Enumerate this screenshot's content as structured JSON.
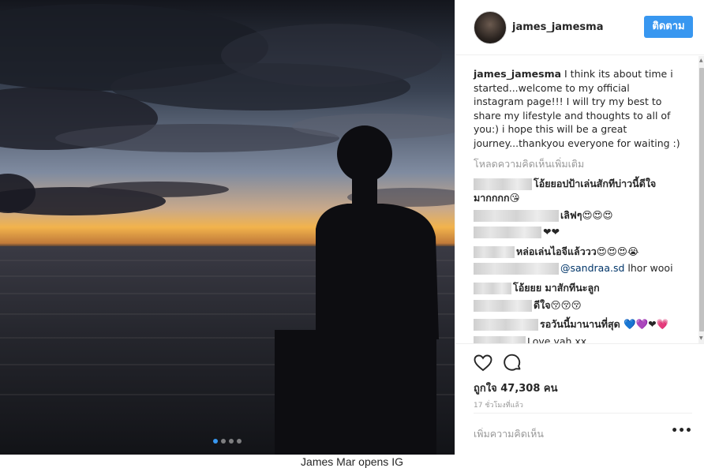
{
  "post": {
    "username": "james_jamesma",
    "follow_label": "ติดตาม",
    "caption_user": "james_jamesma",
    "caption_text": " I think its about time i started...welcome to my official instagram page!!! I will try my best to share my lifestyle and thoughts to all of you:) i hope this will be a great journey...thankyou everyone for waiting :)",
    "load_more": "โหลดความคิดเห็นเพิ่มเติม",
    "likes": "ถูกใจ 47,308 คน",
    "time": "17 ชั่วโมงที่แล้ว",
    "comment_placeholder": "เพิ่มความคิดเห็น",
    "more_label": "•••"
  },
  "comments": [
    {
      "text": "โอ้ยยอปป้าเล่นสักทีบ่าวนี้ดีใจ",
      "line2": "มากกกก😘"
    },
    {
      "text": "เลิฟๆ😍😍😍"
    },
    {
      "text": "❤❤"
    },
    {
      "text": "หล่อเล่นไอจีแล้ววว😍😍😍😭"
    },
    {
      "mention": "@sandraa.sd",
      "text": " lhor wooi"
    },
    {
      "text": "โอ้ยยย มาสักทีนะลูก"
    },
    {
      "text": "ดีใจ😚😚😚"
    },
    {
      "text": "รอวันนี้มานานที่สุด 💙💜❤💗"
    },
    {
      "text": "Love yah xx"
    }
  ],
  "carousel": {
    "count": 4,
    "active": 0
  },
  "page_caption": "James Mar opens IG",
  "colors": {
    "accent": "#3897f0",
    "text": "#262626",
    "muted": "#999999"
  },
  "icons": {
    "like": "heart-icon",
    "comment": "comment-bubble-icon",
    "more": "ellipsis-icon"
  }
}
